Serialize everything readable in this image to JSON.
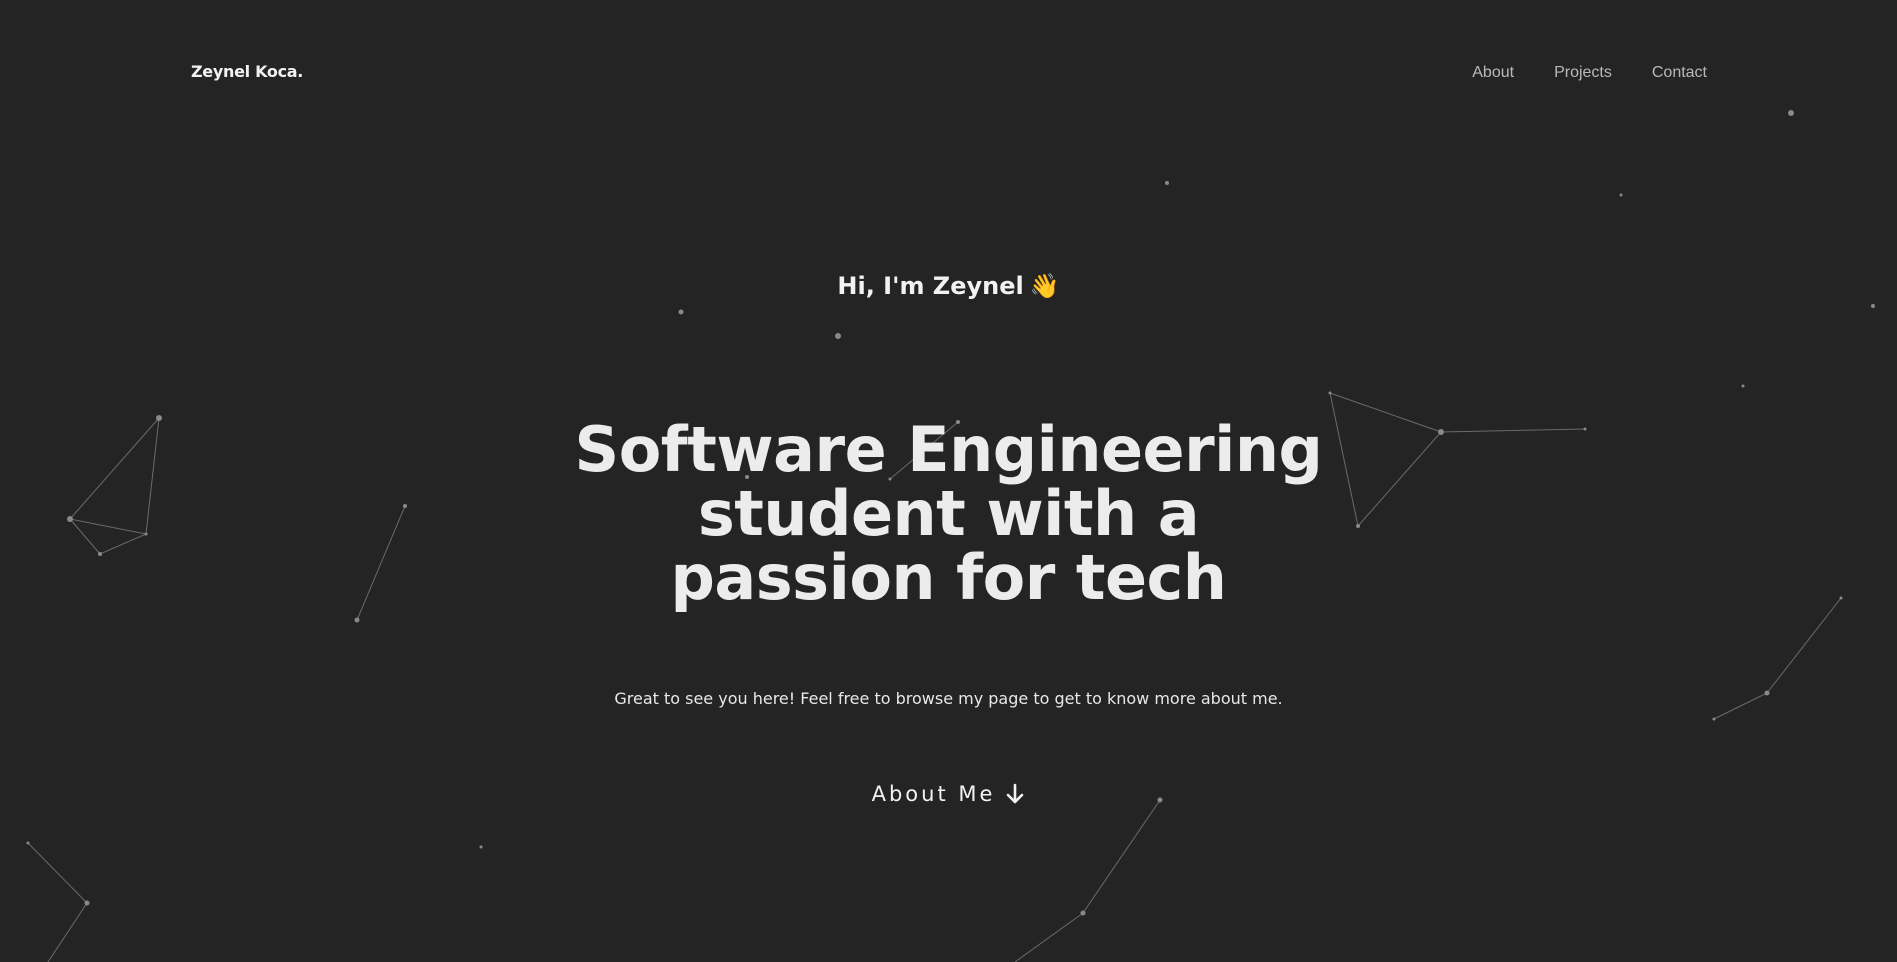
{
  "header": {
    "brand": "Zeynel Koca.",
    "nav": [
      {
        "label": "About"
      },
      {
        "label": "Projects"
      },
      {
        "label": "Contact"
      }
    ]
  },
  "hero": {
    "greeting": "Hi, I'm Zeynel",
    "greeting_emoji": "👋",
    "headline_lines": [
      "Software Engineering",
      "student with a",
      "passion for tech"
    ],
    "subtitle": "Great to see you here! Feel free to browse my page to get to know more about me.",
    "cta_label": "About Me",
    "cta_icon": "arrow-down-icon"
  },
  "colors": {
    "background": "#242424",
    "text": "#ececec",
    "nav_text": "#b9b9b9",
    "particle": "#8a8a8a",
    "particle_line": "#6a6a6a"
  }
}
